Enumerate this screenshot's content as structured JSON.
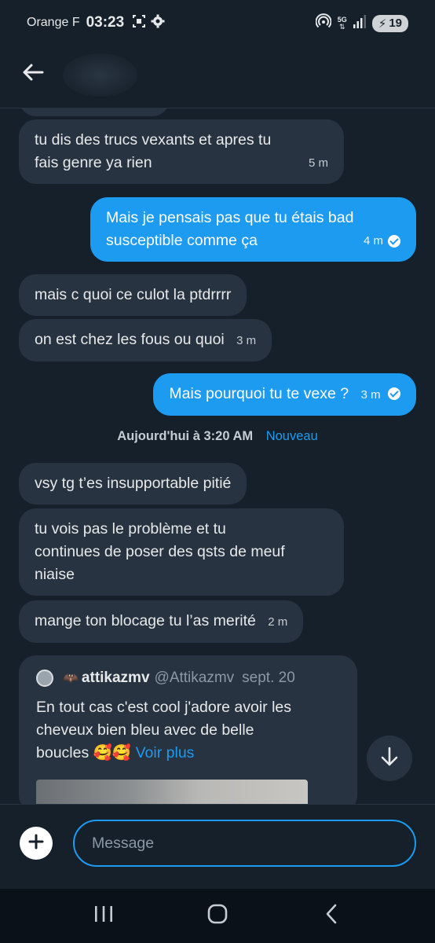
{
  "status_bar": {
    "carrier": "Orange F",
    "time": "03:23",
    "network": "5G",
    "battery": "19",
    "icons": [
      "screen-capture-icon",
      "settings-gear-icon",
      "hotspot-icon",
      "mobile-data-icon",
      "signal-icon",
      "battery-charging-icon"
    ]
  },
  "header": {
    "back_icon": "arrow-left-icon"
  },
  "messages": [
    {
      "id": 1,
      "direction": "in",
      "lines": [
        "tu dis des trucs vexants et apres tu",
        "fais genre ya rien"
      ],
      "time": "5 m"
    },
    {
      "id": 2,
      "direction": "out",
      "lines": [
        "Mais je pensais pas que tu étais bad",
        "susceptible comme ça"
      ],
      "time": "4 m",
      "read": true
    },
    {
      "id": 3,
      "direction": "in",
      "lines": [
        "mais c quoi ce culot la ptdrrrr"
      ],
      "time": ""
    },
    {
      "id": 4,
      "direction": "in",
      "lines": [
        "on est chez les fous ou quoi"
      ],
      "time": "3 m"
    },
    {
      "id": 5,
      "direction": "out",
      "lines": [
        "Mais pourquoi tu te vexe ?"
      ],
      "time": "3 m",
      "read": true
    },
    {
      "id": 6,
      "direction": "in",
      "lines": [
        "vsy tg t’es insupportable pitié"
      ],
      "time": ""
    },
    {
      "id": 7,
      "direction": "in",
      "lines": [
        "tu vois pas le problème et tu",
        "continues de poser des qsts de meuf",
        "niaise"
      ],
      "time": ""
    },
    {
      "id": 8,
      "direction": "in",
      "lines": [
        "mange ton blocage tu l’as merité"
      ],
      "time": "2 m"
    }
  ],
  "divider": {
    "date": "Aujourd'hui à 3:20 AM",
    "new_label": "Nouveau"
  },
  "quoted_post": {
    "name_prefix": "🦇",
    "name": "attikazmv",
    "handle": "@Attikazmv",
    "date": "sept. 20",
    "text_lines": [
      "En tout cas c'est cool j'adore avoir les",
      "cheveux bien bleu avec de belle",
      "boucles 🥰🥰"
    ],
    "more_label": "Voir plus"
  },
  "composer": {
    "placeholder": "Message",
    "add_icon": "plus-circle-icon"
  },
  "nav": {
    "icons": [
      "recent-apps-icon",
      "home-icon",
      "back-icon"
    ]
  },
  "colors": {
    "background": "#15202b",
    "bubble_in": "#273340",
    "bubble_out": "#1d9bf0",
    "accent": "#1d9bf0"
  }
}
